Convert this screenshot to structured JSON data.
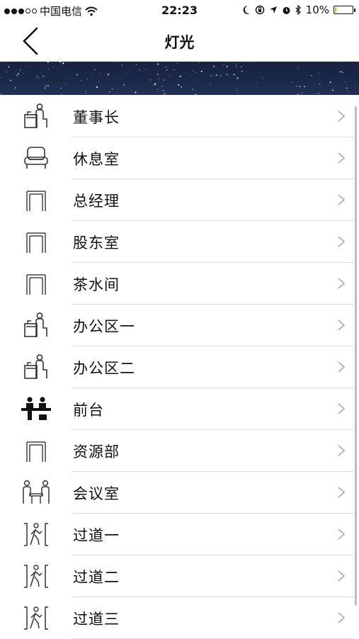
{
  "status": {
    "carrier": "中国电信",
    "time": "22:23",
    "battery": "10%",
    "battery_level": 0.1
  },
  "nav": {
    "title": "灯光"
  },
  "rooms": [
    {
      "label": "董事长",
      "icon": "desk-person-icon"
    },
    {
      "label": "休息室",
      "icon": "sofa-icon"
    },
    {
      "label": "总经理",
      "icon": "doorway-icon"
    },
    {
      "label": "股东室",
      "icon": "doorway-icon"
    },
    {
      "label": "茶水间",
      "icon": "doorway-icon"
    },
    {
      "label": "办公区一",
      "icon": "desk-person-icon"
    },
    {
      "label": "办公区二",
      "icon": "desk-person-icon"
    },
    {
      "label": "前台",
      "icon": "reception-icon"
    },
    {
      "label": "资源部",
      "icon": "doorway-icon"
    },
    {
      "label": "会议室",
      "icon": "meeting-icon"
    },
    {
      "label": "过道一",
      "icon": "walking-person-icon"
    },
    {
      "label": "过道二",
      "icon": "walking-person-icon"
    },
    {
      "label": "过道三",
      "icon": "walking-person-icon"
    }
  ]
}
